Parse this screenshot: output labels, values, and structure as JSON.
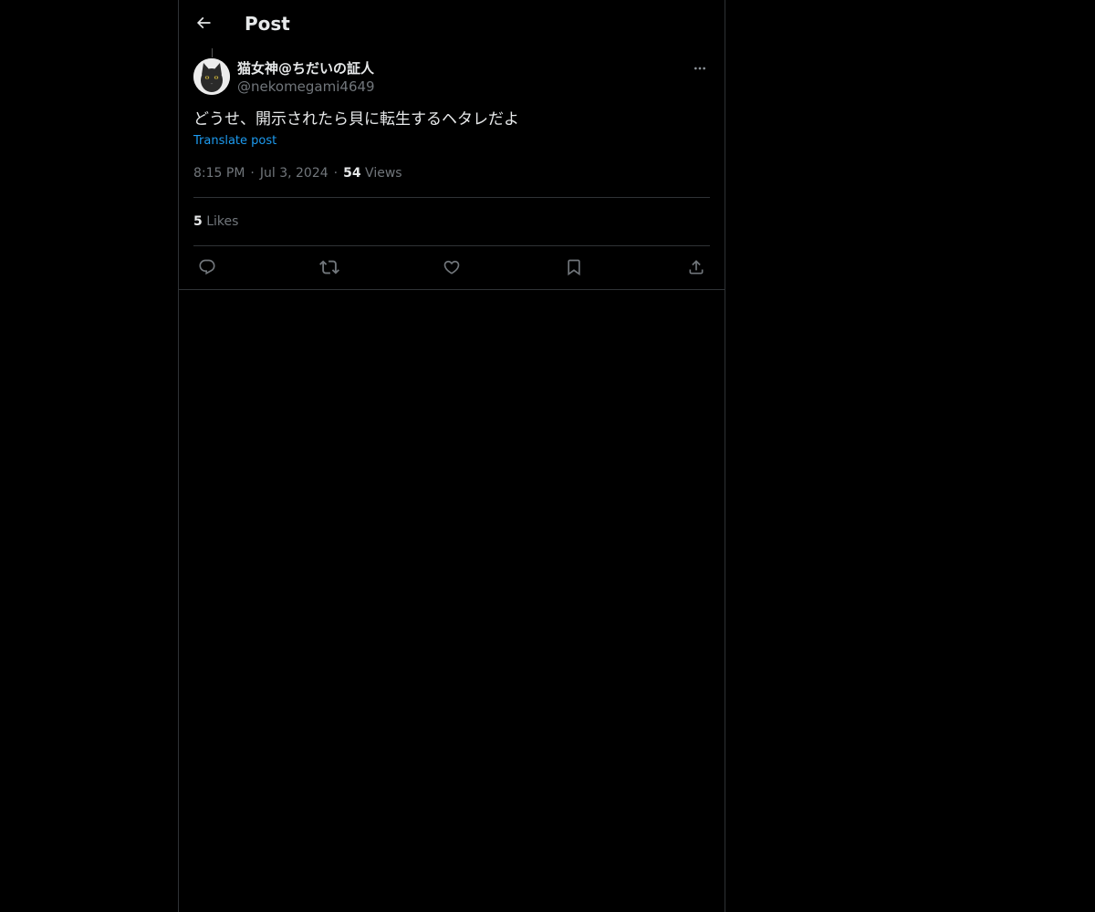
{
  "header": {
    "title": "Post",
    "back_icon": "arrow-left-icon"
  },
  "post": {
    "author": {
      "display_name": "猫女神@ちだいの証人",
      "handle": "@nekomegami4649",
      "avatar": "cat-avatar"
    },
    "text": "どうせ、開示されたら貝に転生するヘタレだよ",
    "translate_label": "Translate post",
    "time": "8:15 PM",
    "date": "Jul 3, 2024",
    "views_count": "54",
    "views_label": "Views",
    "likes_count": "5",
    "likes_label": "Likes"
  },
  "actions": [
    "reply-icon",
    "repost-icon",
    "like-icon",
    "bookmark-icon",
    "share-icon"
  ],
  "colors": {
    "background": "#000000",
    "text": "#e7e9ea",
    "muted": "#71767b",
    "link": "#1d9bf0",
    "border": "#2f3336"
  }
}
